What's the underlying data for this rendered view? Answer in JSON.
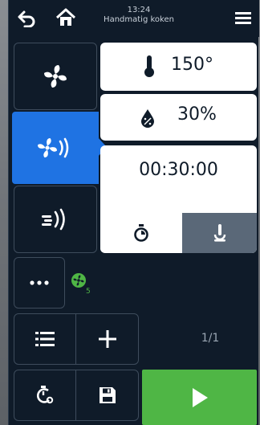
{
  "header": {
    "time": "13:24",
    "title": "Handmatig koken",
    "back_icon": "back-arrow-icon",
    "home_icon": "home-icon",
    "menu_icon": "hamburger-menu-icon"
  },
  "modes": [
    {
      "icon": "fan-icon",
      "active": false
    },
    {
      "icon": "fan-steam-icon",
      "active": true
    },
    {
      "icon": "steam-icon",
      "active": false
    }
  ],
  "settings": {
    "temperature": "150°",
    "humidity": "30%",
    "timer": "00:30:00",
    "timer_tab_icon": "stopwatch-icon",
    "core_probe_tab_icon": "core-probe-icon"
  },
  "status": {
    "fan_speed_badge": "5",
    "page_indicator": "1/1"
  },
  "colors": {
    "background": "#0f1b29",
    "accent_blue": "#1f73e3",
    "start_green": "#4fb645",
    "panel_white": "#ffffff",
    "tab_gray": "#5a6878"
  }
}
